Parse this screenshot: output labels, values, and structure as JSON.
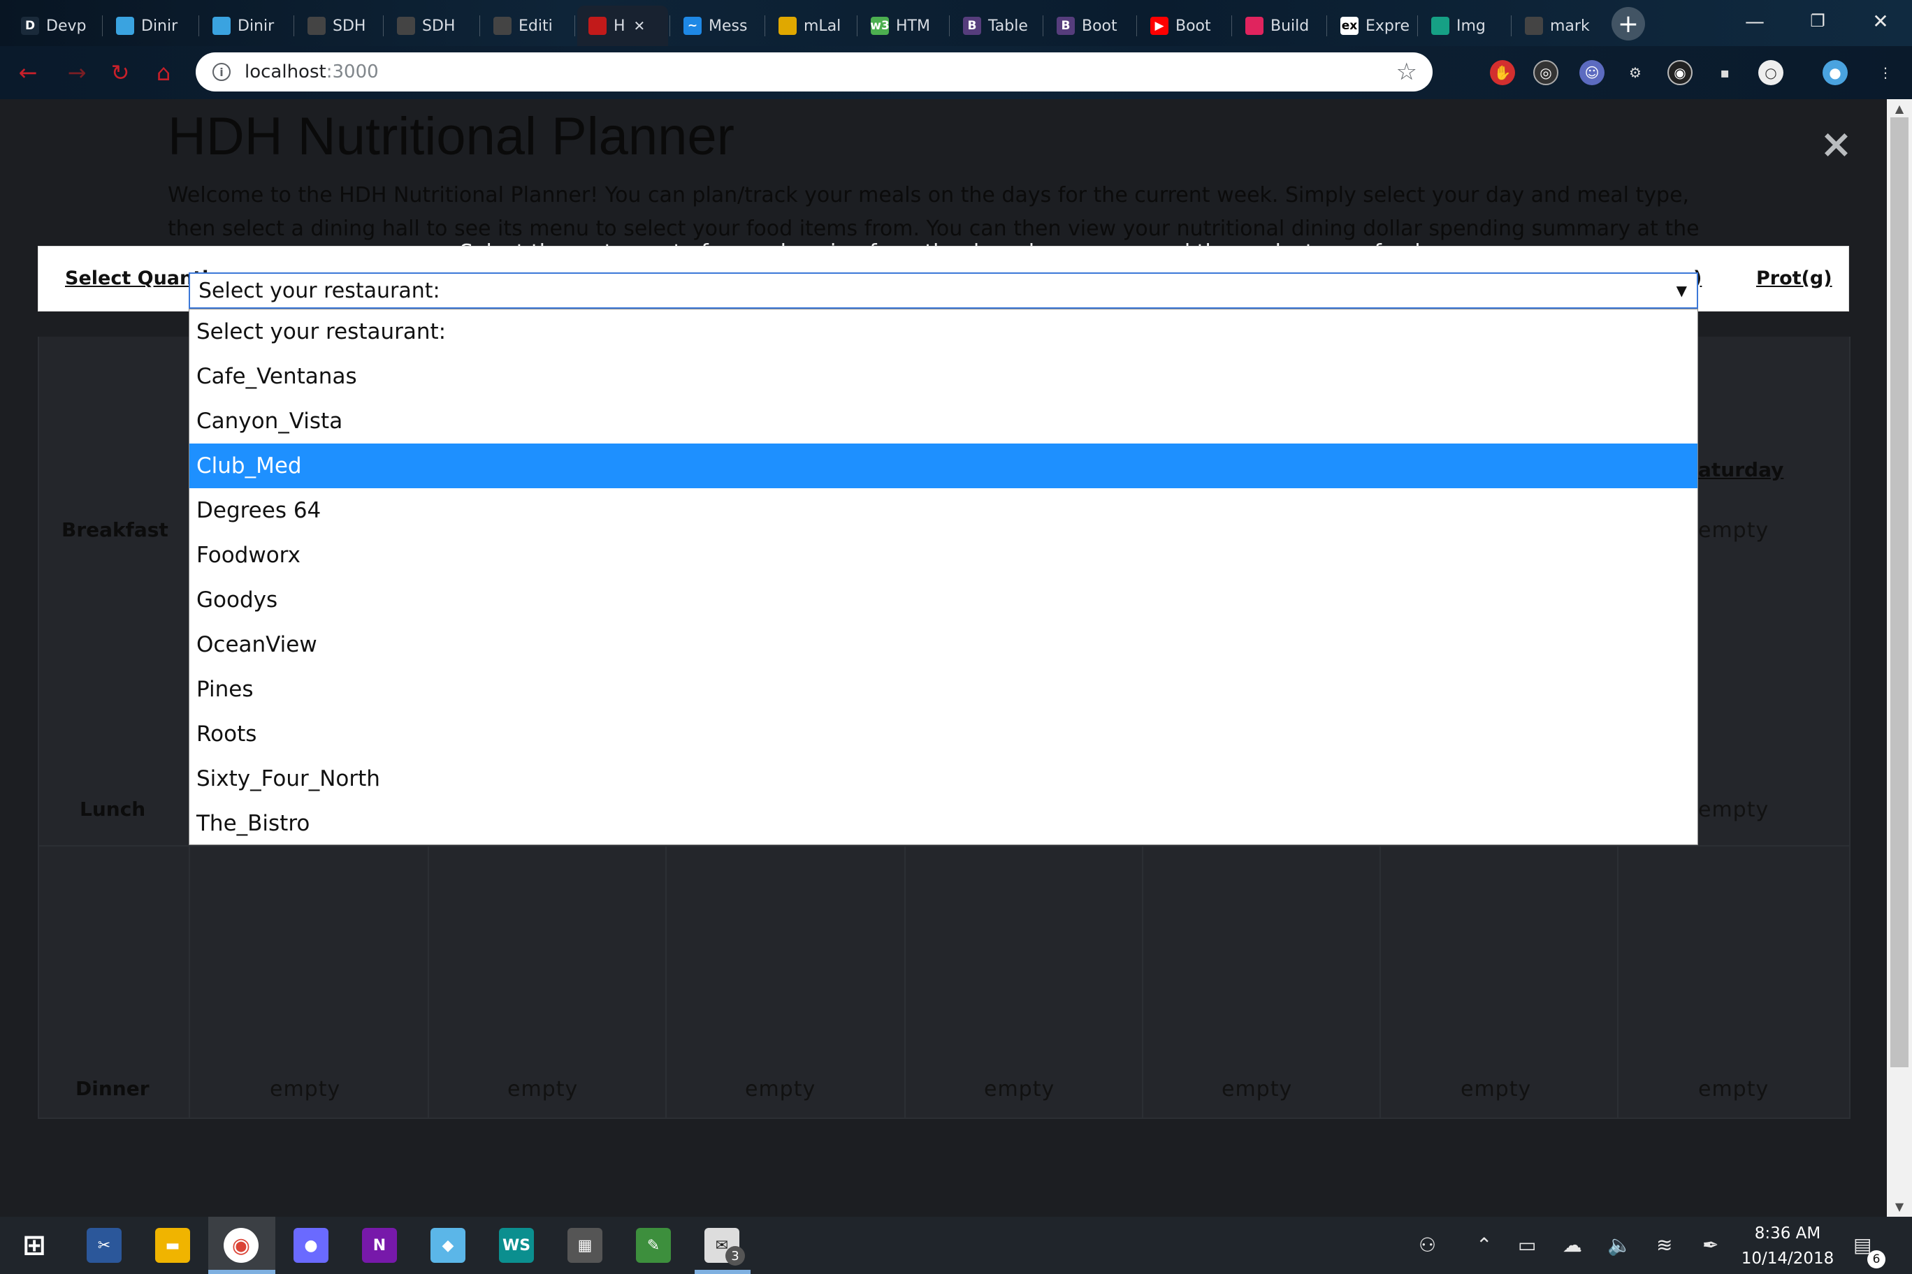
{
  "browser": {
    "tabs": [
      {
        "label": "Devp",
        "icon": "devpost-icon",
        "color": "#1a2a3a",
        "glyph": "D"
      },
      {
        "label": "Dinir",
        "icon": "dining-icon",
        "color": "#3aa3e0",
        "glyph": ""
      },
      {
        "label": "Dinir",
        "icon": "dining-icon",
        "color": "#3aa3e0",
        "glyph": ""
      },
      {
        "label": "SDH",
        "icon": "github-icon",
        "color": "#444",
        "glyph": ""
      },
      {
        "label": "SDH",
        "icon": "github-icon",
        "color": "#444",
        "glyph": ""
      },
      {
        "label": "Editi",
        "icon": "github-icon",
        "color": "#444",
        "glyph": ""
      },
      {
        "label": "H",
        "icon": "page-icon",
        "color": "#c21a1a",
        "glyph": ""
      },
      {
        "label": "Mess",
        "icon": "messenger-icon",
        "color": "#1e88e5",
        "glyph": "~"
      },
      {
        "label": "mLal",
        "icon": "mlab-icon",
        "color": "#e0a800",
        "glyph": ""
      },
      {
        "label": "HTM",
        "icon": "w3schools-icon",
        "color": "#4caf50",
        "glyph": "w3"
      },
      {
        "label": "Table",
        "icon": "bootstrap-icon",
        "color": "#563d7c",
        "glyph": "B"
      },
      {
        "label": "Boot",
        "icon": "bootstrap-icon",
        "color": "#563d7c",
        "glyph": "B"
      },
      {
        "label": "Boot",
        "icon": "youtube-icon",
        "color": "#ff0000",
        "glyph": "▶"
      },
      {
        "label": "Build",
        "icon": "build-icon",
        "color": "#e0245e",
        "glyph": ""
      },
      {
        "label": "Expre",
        "icon": "express-icon",
        "color": "#fff",
        "glyph": "ex"
      },
      {
        "label": "Img",
        "icon": "image-icon",
        "color": "#16a085",
        "glyph": ""
      },
      {
        "label": "mark",
        "icon": "github-icon",
        "color": "#444",
        "glyph": ""
      }
    ],
    "address": {
      "host": "localhost",
      "port": ":3000"
    }
  },
  "page": {
    "title": "HDH Nutritional Planner",
    "welcome": "Welcome to the HDH Nutritional Planner! You can plan/track your meals on the days for the current week. Simply select your day and meal type, then select a dining hall to see its menu to select your food items from. You can then view your nutritional dining dollar spending summary at the bottom of this page.",
    "instruction": "Select the restaurant of your choosing from the drop-down menu and then select your food.",
    "close_label": "×",
    "quantity_header": "Select Quanti",
    "prot_header": "Prot(g)",
    "partial_header": ")",
    "saturday_label": "aturday",
    "row_labels": {
      "breakfast": "Breakfast",
      "lunch": "Lunch",
      "dinner": "Dinner"
    },
    "empty_label": "empty"
  },
  "select": {
    "value": "Select your restaurant:",
    "options": [
      "Select your restaurant:",
      "Cafe_Ventanas",
      "Canyon_Vista",
      "Club_Med",
      "Degrees 64",
      "Foodworx",
      "Goodys",
      "OceanView",
      "Pines",
      "Roots",
      "Sixty_Four_North",
      "The_Bistro"
    ],
    "highlighted": "Club_Med"
  },
  "taskbar": {
    "clock_time": "8:36 AM",
    "clock_date": "10/14/2018",
    "notification_count": "6",
    "mail_badge": "3"
  }
}
